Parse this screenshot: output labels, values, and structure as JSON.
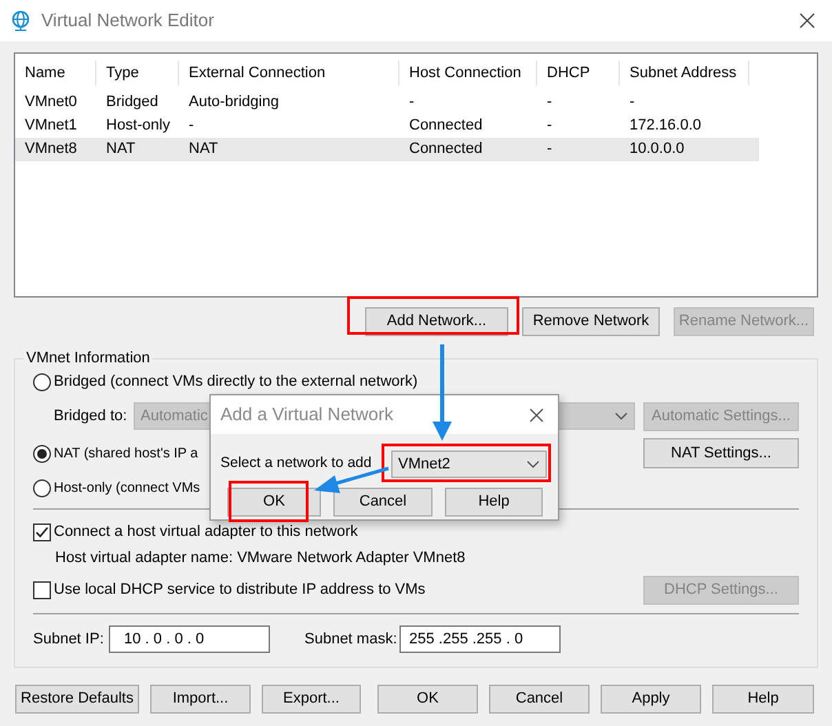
{
  "window": {
    "title": "Virtual Network Editor"
  },
  "table": {
    "columns": [
      "Name",
      "Type",
      "External Connection",
      "Host Connection",
      "DHCP",
      "Subnet Address"
    ],
    "rows": [
      {
        "cells": [
          "VMnet0",
          "Bridged",
          "Auto-bridging",
          "-",
          "-",
          "-"
        ],
        "selected": false
      },
      {
        "cells": [
          "VMnet1",
          "Host-only",
          "-",
          "Connected",
          "-",
          "172.16.0.0"
        ],
        "selected": false
      },
      {
        "cells": [
          "VMnet8",
          "NAT",
          "NAT",
          "Connected",
          "-",
          "10.0.0.0"
        ],
        "selected": true
      }
    ]
  },
  "table_buttons": [
    {
      "label": "Add Network...",
      "disabled": false
    },
    {
      "label": "Remove Network",
      "disabled": false
    },
    {
      "label": "Rename Network...",
      "disabled": true
    }
  ],
  "vmnet_information": {
    "title": "VMnet Information",
    "options": [
      {
        "label": "Bridged (connect VMs directly to the external network)",
        "selected": false
      },
      {
        "label": "NAT (shared host's IP a",
        "selected": true
      },
      {
        "label": "Host-only (connect VMs",
        "selected": false
      }
    ],
    "bridged_to": {
      "label": "Bridged to:",
      "value": "Automatic",
      "disabled": true
    },
    "automatic_settings": {
      "label": "Automatic Settings...",
      "disabled": true
    },
    "nat_settings": {
      "label": "NAT Settings...",
      "disabled": false
    },
    "connect_adapter": {
      "label": "Connect a host virtual adapter to this network",
      "checked": true
    },
    "adapter_name": "Host virtual adapter name: VMware Network Adapter VMnet8",
    "use_dhcp": {
      "label": "Use local DHCP service to distribute IP address to VMs",
      "checked": false
    },
    "dhcp_settings": {
      "label": "DHCP Settings...",
      "disabled": true
    },
    "subnet_ip": {
      "label": "Subnet IP:",
      "value": "10 . 0 . 0 . 0"
    },
    "subnet_mask": {
      "label": "Subnet mask:",
      "value": "255 .255 .255 . 0"
    }
  },
  "footer_buttons": [
    "Restore Defaults",
    "Import...",
    "Export...",
    "OK",
    "Cancel",
    "Apply",
    "Help"
  ],
  "dialog": {
    "title": "Add a Virtual Network",
    "label": "Select a network to add",
    "network": "VMnet2",
    "buttons": [
      "OK",
      "Cancel",
      "Help"
    ]
  }
}
